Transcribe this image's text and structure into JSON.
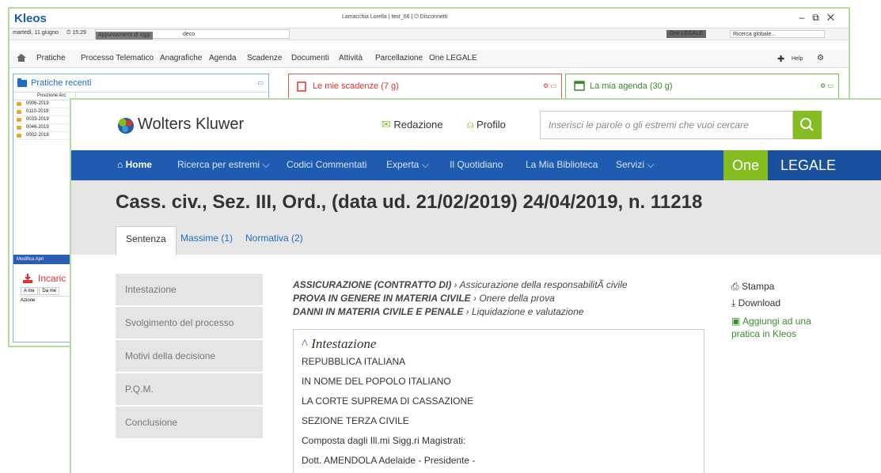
{
  "kleos": {
    "app_title": "Kleos",
    "user": "Lamacchia Lorella  |  test_66  |  ⏻ Disconnetti",
    "date": "martedì, 11 giugno",
    "time": "⏱ 15:29",
    "appointments_button": "Appuntamenti di oggi",
    "appointments_placeholder": "deco",
    "one_legale": "One LEGALE",
    "global_search": "Ricerca globale...",
    "menu": [
      "Pratiche",
      "Processo Telematico",
      "Anagrafiche",
      "Agenda",
      "Scadenze",
      "Documenti",
      "Attività",
      "Parcellazione",
      "One LEGALE"
    ],
    "help": "Help",
    "recent_title": "Pratiche recenti",
    "recent_col_header": "Posizione Arc",
    "recent_rows": [
      "0006-2019",
      "0110-2019",
      "0033-2019",
      "0046-2019",
      "0002-2018"
    ],
    "recent_footer": "Modifica   Apri",
    "deadlines_title": "Le mie scadenze (7 g)",
    "agenda_title": "La mia agenda (30 g)",
    "assignments_title": "Incaric",
    "assign_tabs": [
      "A me",
      "Da me"
    ],
    "assign_col": "Azione"
  },
  "wk": {
    "brand": "Wolters Kluwer",
    "redazione": "Redazione",
    "profilo": "Profilo",
    "search_placeholder": "Inserisci le parole o gli estremi che vuoi cercare",
    "nav": [
      "Home",
      "Ricerca per estremi ⌵",
      "Codici Commentati",
      "Experta ⌵",
      "Il Quotidiano",
      "La Mia Biblioteca",
      "Servizi ⌵"
    ],
    "one": "One",
    "legale": "LEGALE",
    "doc_title": "Cass. civ., Sez. III, Ord., (data ud. 21/02/2019) 24/04/2019, n. 11218",
    "tabs": [
      "Sentenza",
      "Massime (1)",
      "Normativa (2)"
    ],
    "left_menu": [
      "Intestazione",
      "Svolgimento del processo",
      "Motivi della decisione",
      "P.Q.M.",
      "Conclusione"
    ],
    "subjects": [
      {
        "bold": "ASSICURAZIONE (CONTRATTO DI)",
        "rest": " › Assicurazione della responsabilitÃ  civile"
      },
      {
        "bold": "PROVA IN GENERE IN MATERIA CIVILE",
        "rest": " › Onere della prova"
      },
      {
        "bold": "DANNI IN MATERIA CIVILE E PENALE",
        "rest": " › Liquidazione e valutazione"
      }
    ],
    "section_heading": "Intestazione",
    "section_lines": [
      "REPUBBLICA ITALIANA",
      "IN NOME DEL POPOLO ITALIANO",
      "LA CORTE SUPREMA DI CASSAZIONE",
      "SEZIONE TERZA CIVILE",
      "Composta dagli Ill.mi Sigg.ri Magistrati:",
      "Dott. AMENDOLA Adelaide - Presidente -"
    ],
    "actions": {
      "print": "Stampa",
      "download": "Download",
      "add": "Aggiungi ad una pratica in Kleos"
    },
    "colors": {
      "nav_blue": "#1f5bb0",
      "green": "#85bc22"
    }
  }
}
